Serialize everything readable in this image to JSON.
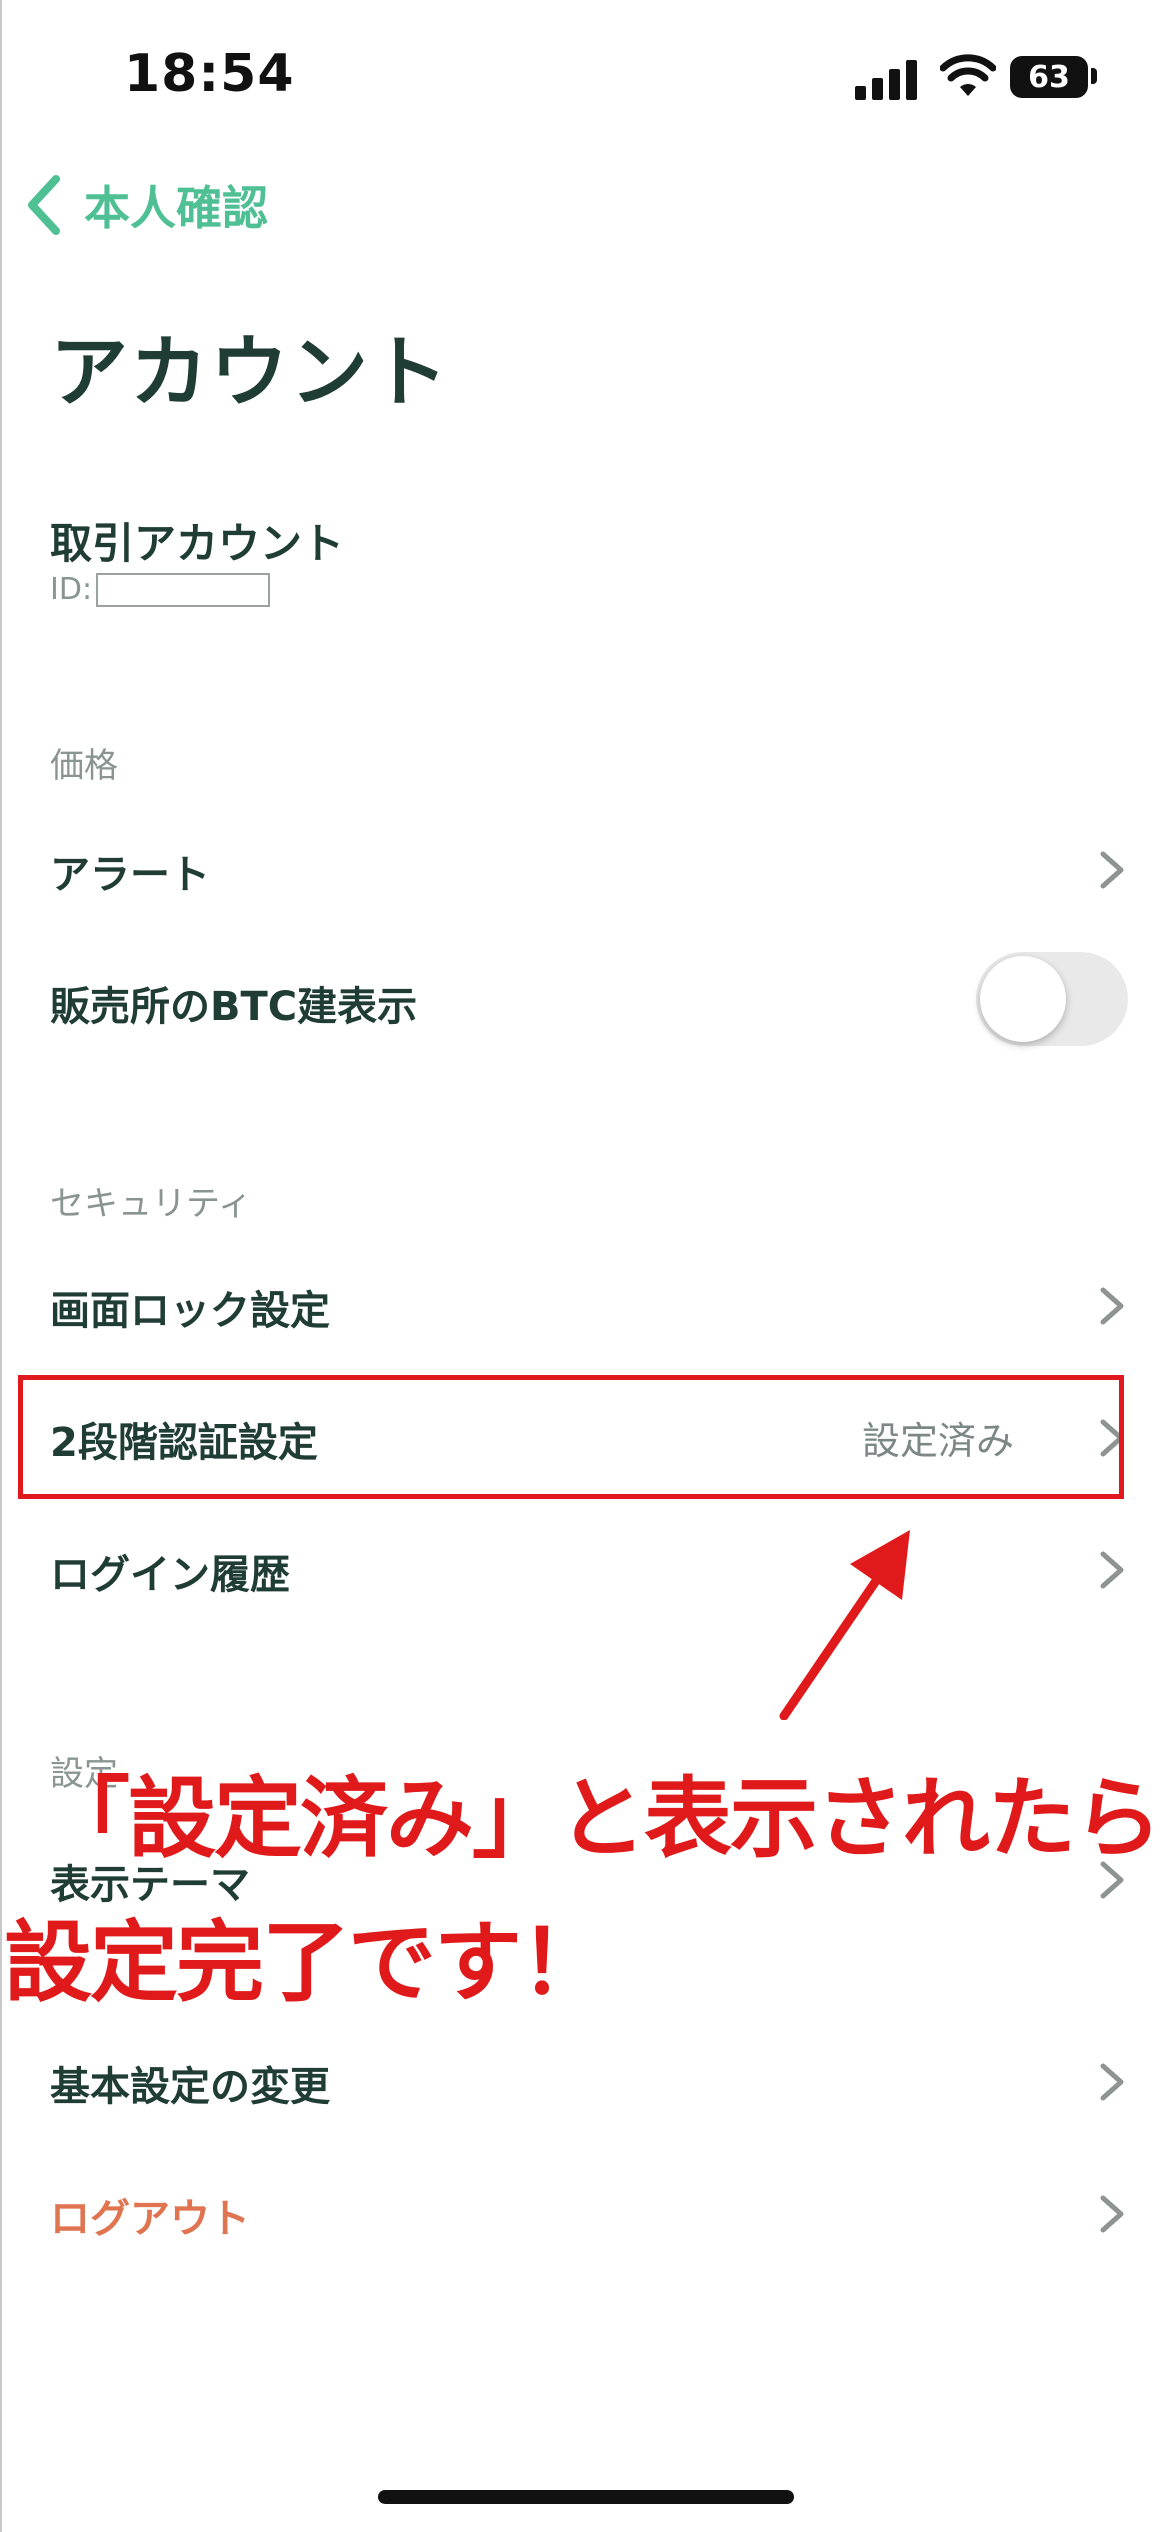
{
  "status_bar": {
    "time": "18:54",
    "battery": "63"
  },
  "nav": {
    "back_label": "本人確認"
  },
  "page_title": "アカウント",
  "account": {
    "title": "取引アカウント",
    "id_label": "ID:"
  },
  "sections": {
    "price": "価格",
    "security": "セキュリティ",
    "settings": "設定"
  },
  "rows": {
    "alert": "アラート",
    "btc_display": "販売所のBTC建表示",
    "btc_display_toggle_on": false,
    "screen_lock": "画面ロック設定",
    "two_factor": "2段階認証設定",
    "two_factor_status": "設定済み",
    "login_history": "ログイン履歴",
    "theme": "表示テーマ",
    "basic_settings": "基本設定の変更",
    "logout": "ログアウト"
  },
  "annotation": {
    "line1": "「設定済み」と表示されたら",
    "line2": "設定完了です！"
  },
  "colors": {
    "accent": "#4fbf94",
    "text": "#203d35",
    "muted": "#8a9592",
    "logout": "#e07350",
    "annotation": "#e01a1a"
  }
}
